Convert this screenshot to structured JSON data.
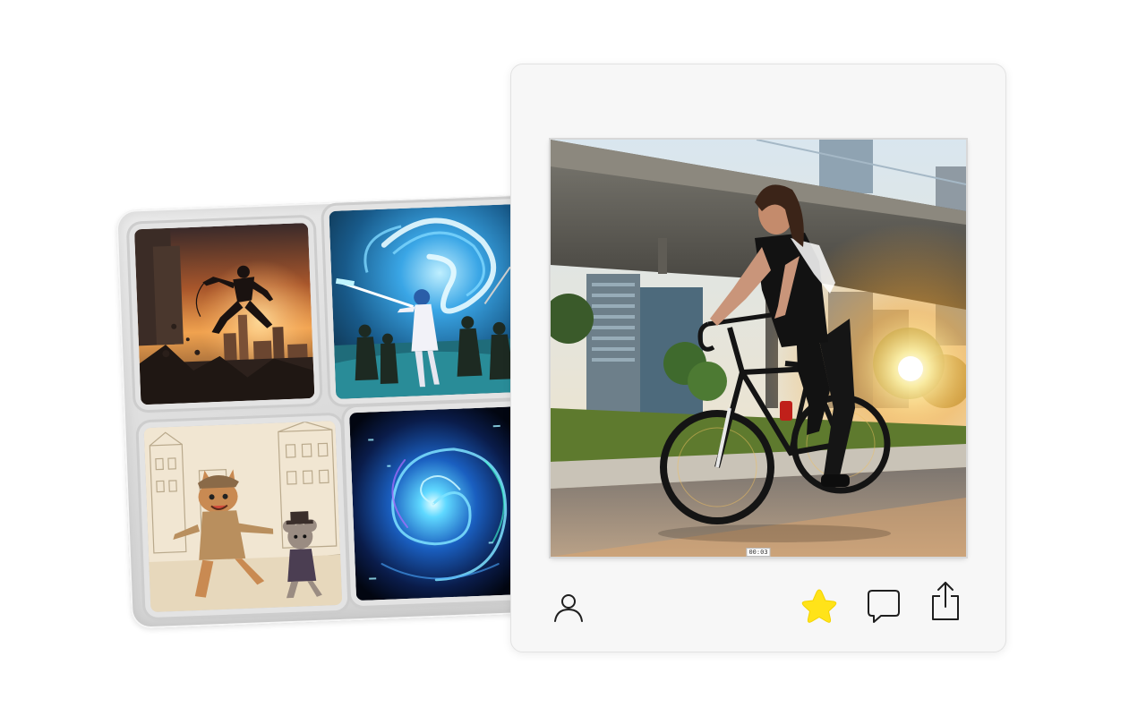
{
  "gallery": {
    "tiles": [
      {
        "icon": "action-hero-rooftop-image"
      },
      {
        "icon": "anime-dragon-battle-image"
      },
      {
        "icon": "cartoon-cat-mouse-image"
      },
      {
        "icon": "cosmic-vortex-image"
      }
    ]
  },
  "post": {
    "media": {
      "icon": "cyclist-video-thumbnail",
      "timestamp": "00:03"
    },
    "actions": {
      "profile_icon": "user-icon",
      "favorite_icon": "star-icon",
      "comment_icon": "comment-icon",
      "share_icon": "share-icon",
      "favorite_active": true
    }
  },
  "colors": {
    "star_fill": "#FFE319",
    "icon_stroke": "#1f1f1f",
    "card_bg": "#F7F7F7",
    "panel_bg": "#D9D9D9"
  }
}
